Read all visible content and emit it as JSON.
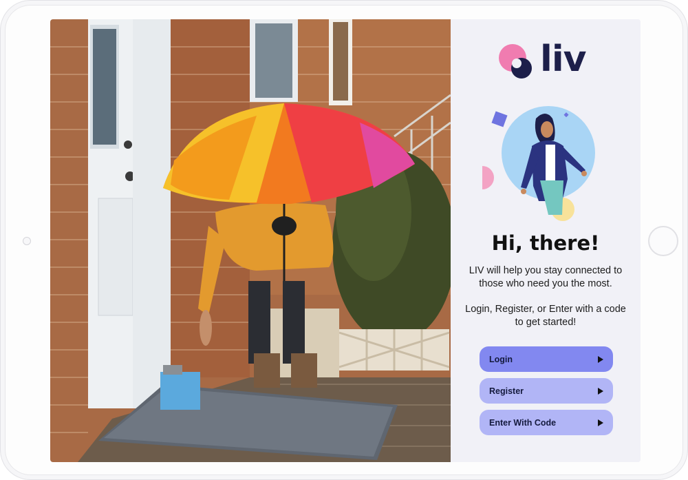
{
  "brand": {
    "name": "liv",
    "colors": {
      "pink": "#f07cb0",
      "navy": "#1d1f4a",
      "primary_button": "#8288f0",
      "secondary_button": "#b1b5f6",
      "panel_background": "#f1f1f7"
    }
  },
  "welcome": {
    "title": "Hi, there!",
    "intro": "LIV will help you stay connected to those who need you the most.",
    "instructions": "Login, Register, or Enter with a code to get started!"
  },
  "actions": {
    "login": "Login",
    "register": "Register",
    "enter_code": "Enter With Code",
    "arrow_icon": "play-arrow-icon"
  }
}
